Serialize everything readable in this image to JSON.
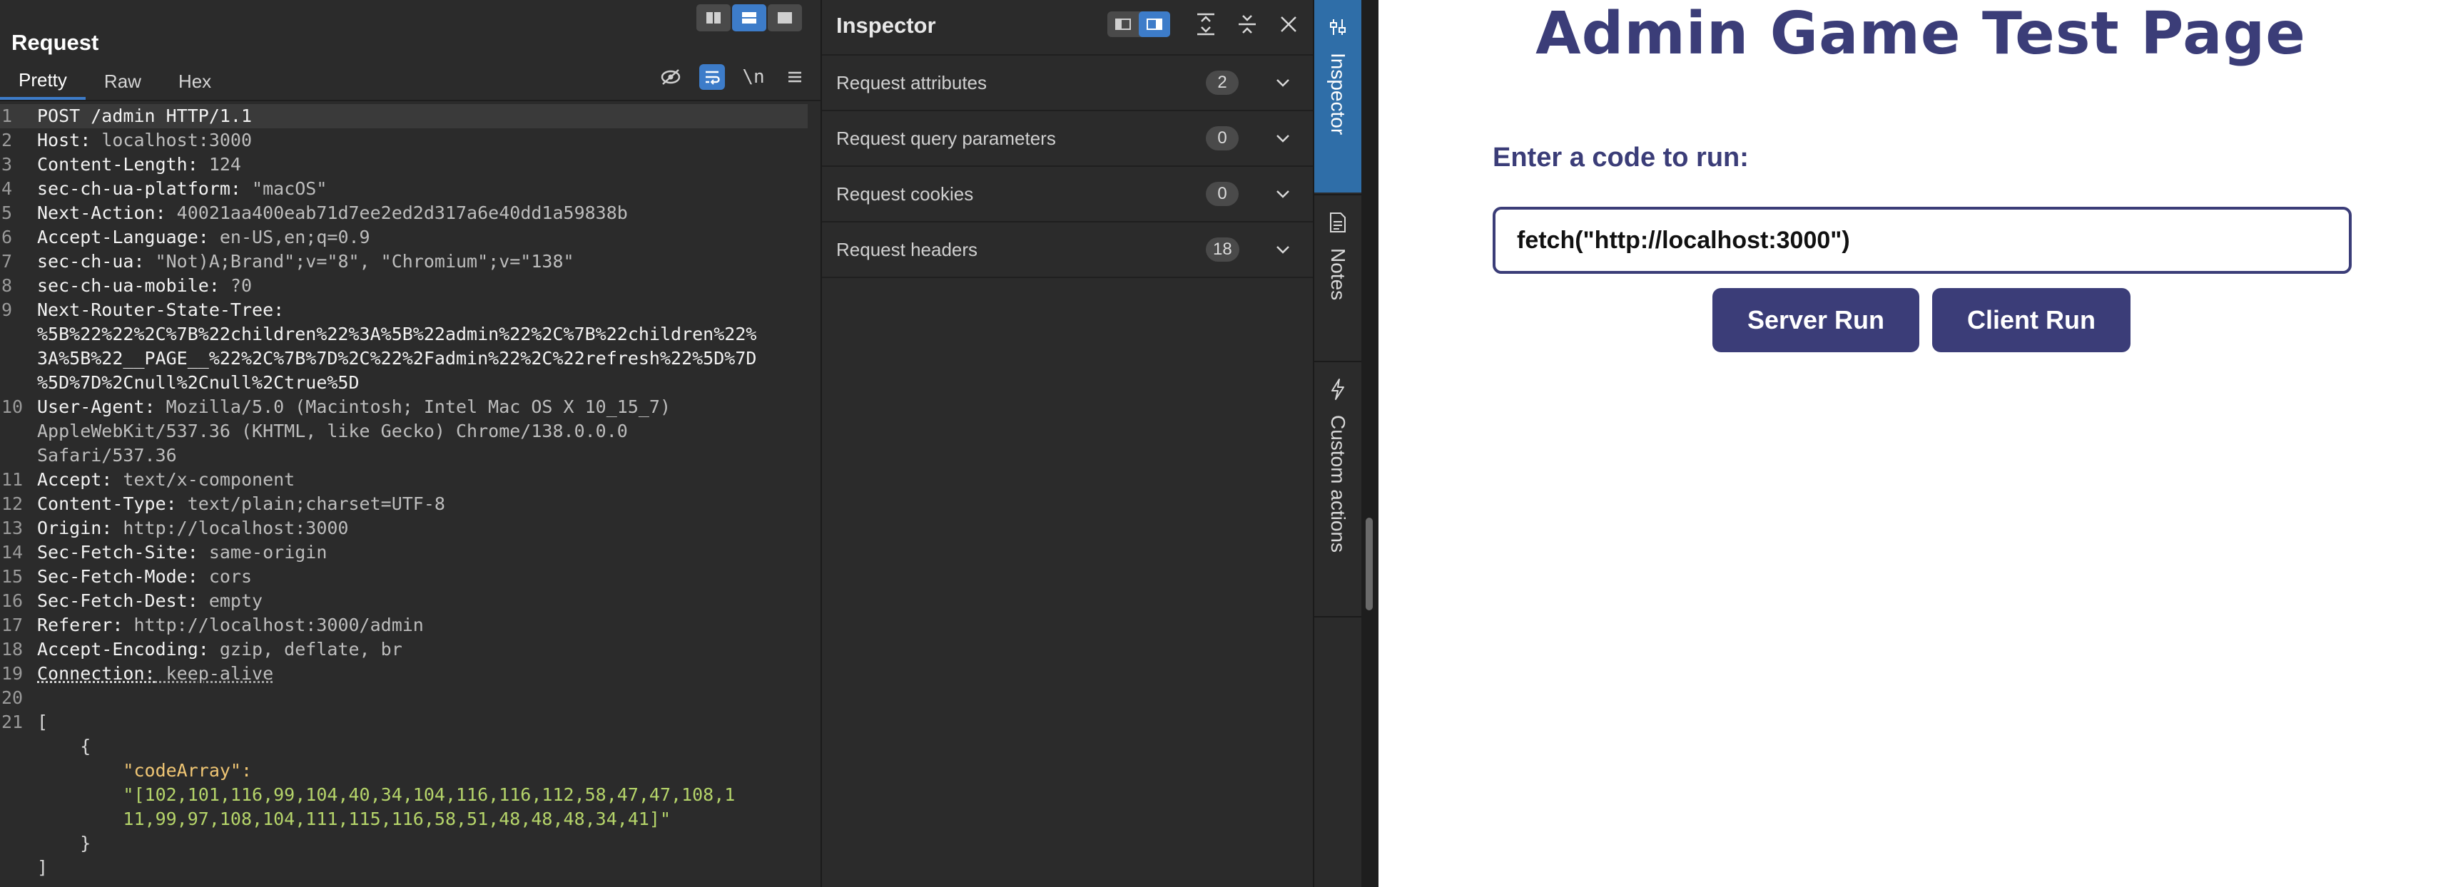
{
  "request": {
    "title": "Request",
    "tabs": [
      {
        "label": "Pretty",
        "active": true
      },
      {
        "label": "Raw",
        "active": false
      },
      {
        "label": "Hex",
        "active": false
      }
    ],
    "newline_toggle": "\\n",
    "lines": [
      {
        "n": "1",
        "key": "POST /admin HTTP/1.1",
        "val": ""
      },
      {
        "n": "2",
        "key": "Host:",
        "val": " localhost:3000"
      },
      {
        "n": "3",
        "key": "Content-Length:",
        "val": " 124"
      },
      {
        "n": "4",
        "key": "sec-ch-ua-platform:",
        "val": " \"macOS\""
      },
      {
        "n": "5",
        "key": "Next-Action:",
        "val": " 40021aa400eab71d7ee2ed2d317a6e40dd1a59838b"
      },
      {
        "n": "6",
        "key": "Accept-Language:",
        "val": " en-US,en;q=0.9"
      },
      {
        "n": "7",
        "key": "sec-ch-ua:",
        "val": " \"Not)A;Brand\";v=\"8\", \"Chromium\";v=\"138\""
      },
      {
        "n": "8",
        "key": "sec-ch-ua-mobile:",
        "val": " ?0"
      },
      {
        "n": "9",
        "key": "Next-Router-State-Tree:",
        "val": ""
      },
      {
        "n": "",
        "key": "%5B%22%22%2C%7B%22children%22%3A%5B%22admin%22%2C%7B%22children%22%",
        "val": ""
      },
      {
        "n": "",
        "key": "3A%5B%22__PAGE__%22%2C%7B%7D%2C%22%2Fadmin%22%2C%22refresh%22%5D%7D",
        "val": ""
      },
      {
        "n": "",
        "key": "%5D%7D%2Cnull%2Cnull%2Ctrue%5D",
        "val": ""
      },
      {
        "n": "10",
        "key": "User-Agent:",
        "val": " Mozilla/5.0 (Macintosh; Intel Mac OS X 10_15_7)"
      },
      {
        "n": "",
        "key": "",
        "val": "AppleWebKit/537.36 (KHTML, like Gecko) Chrome/138.0.0.0"
      },
      {
        "n": "",
        "key": "",
        "val": "Safari/537.36"
      },
      {
        "n": "11",
        "key": "Accept:",
        "val": " text/x-component"
      },
      {
        "n": "12",
        "key": "Content-Type:",
        "val": " text/plain;charset=UTF-8"
      },
      {
        "n": "13",
        "key": "Origin:",
        "val": " http://localhost:3000"
      },
      {
        "n": "14",
        "key": "Sec-Fetch-Site:",
        "val": " same-origin"
      },
      {
        "n": "15",
        "key": "Sec-Fetch-Mode:",
        "val": " cors"
      },
      {
        "n": "16",
        "key": "Sec-Fetch-Dest:",
        "val": " empty"
      },
      {
        "n": "17",
        "key": "Referer:",
        "val": " http://localhost:3000/admin"
      },
      {
        "n": "18",
        "key": "Accept-Encoding:",
        "val": " gzip, deflate, br"
      },
      {
        "n": "19",
        "key": "Connection:",
        "val": " keep-alive"
      },
      {
        "n": "20",
        "key": "",
        "val": ""
      },
      {
        "n": "21",
        "key": "[",
        "val": ""
      },
      {
        "n": "",
        "key": "    {",
        "val": ""
      },
      {
        "n": "",
        "key": "",
        "val": "",
        "json_key": "        \"codeArray\":"
      },
      {
        "n": "",
        "key": "",
        "val": "",
        "json_str": "        \"[102,101,116,99,104,40,34,104,116,116,112,58,47,47,108,1"
      },
      {
        "n": "",
        "key": "",
        "val": "",
        "json_str": "        11,99,97,108,104,111,115,116,58,51,48,48,48,34,41]\""
      },
      {
        "n": "",
        "key": "    }",
        "val": ""
      },
      {
        "n": "",
        "key": "]",
        "val": ""
      }
    ]
  },
  "inspector": {
    "title": "Inspector",
    "rows": [
      {
        "label": "Request attributes",
        "count": "2"
      },
      {
        "label": "Request query parameters",
        "count": "0"
      },
      {
        "label": "Request cookies",
        "count": "0"
      },
      {
        "label": "Request headers",
        "count": "18"
      }
    ]
  },
  "sidebar": {
    "tabs": [
      {
        "label": "Inspector",
        "active": true
      },
      {
        "label": "Notes",
        "active": false
      },
      {
        "label": "Custom actions",
        "active": false
      }
    ]
  },
  "webpage": {
    "title": "Admin Game Test Page",
    "code_label": "Enter a code to run:",
    "code_value": "fetch(\"http://localhost:3000\")",
    "server_button": "Server Run",
    "client_button": "Client Run",
    "accent_color": "#3b3d78"
  },
  "colors": {
    "panel_bg": "#2b2b2b",
    "accent_blue": "#3d7cc9",
    "header_key": "#f2f2f2",
    "header_value": "#bdbdbd",
    "json_key": "#f0c674",
    "json_string": "#b5d46a"
  }
}
